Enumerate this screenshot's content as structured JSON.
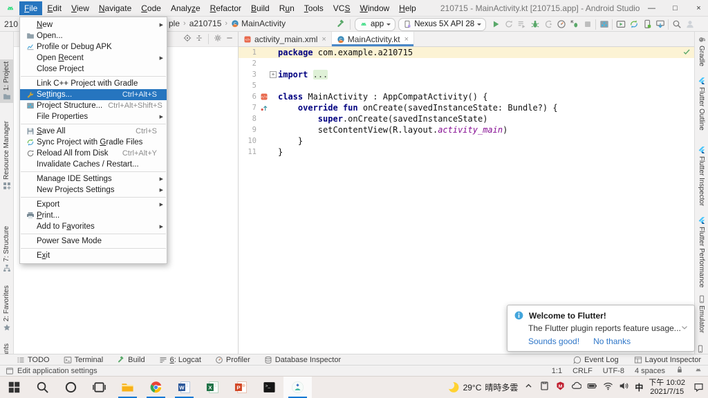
{
  "window": {
    "title": "210715 - MainActivity.kt [210715.app] - Android Studio"
  },
  "menubar": {
    "items": [
      {
        "label": "&File",
        "active": true
      },
      {
        "label": "&Edit"
      },
      {
        "label": "&View"
      },
      {
        "label": "&Navigate"
      },
      {
        "label": "&Code"
      },
      {
        "label": "Analy&ze"
      },
      {
        "label": "&Refactor"
      },
      {
        "label": "&Build"
      },
      {
        "label": "R&un"
      },
      {
        "label": "&Tools"
      },
      {
        "label": "VC&S"
      },
      {
        "label": "&Window"
      },
      {
        "label": "&Help"
      }
    ]
  },
  "navbar": {
    "left_fragment": "210",
    "crumbs": [
      {
        "label": "ple"
      },
      {
        "label": "a210715"
      },
      {
        "label": "MainActivity",
        "icon": "kotlinclass"
      }
    ],
    "separator": "›"
  },
  "toolbar": {
    "build_icon": "hammer",
    "run_config": {
      "icon": "android",
      "label": "app"
    },
    "device": {
      "icon": "device",
      "label": "Nexus 5X API 28"
    },
    "actions": [
      {
        "icon": "run",
        "name": "run-button"
      },
      {
        "icon": "rerun",
        "name": "rerun-button"
      },
      {
        "icon": "runlist",
        "name": "run-configurations-button"
      },
      {
        "icon": "debug",
        "name": "debug-button"
      },
      {
        "icon": "attach",
        "name": "attach-debugger-button"
      },
      {
        "icon": "profiler",
        "name": "profile-app-button"
      },
      {
        "icon": "debugattach",
        "name": "attach-profiler-button"
      },
      {
        "icon": "stop",
        "name": "stop-button"
      },
      "|",
      {
        "icon": "structure",
        "name": "project-structure-button"
      },
      "|",
      {
        "icon": "avd",
        "name": "avd-manager-button"
      },
      {
        "icon": "sync",
        "name": "gradle-sync-button"
      },
      {
        "icon": "devicemgr",
        "name": "device-manager-button"
      },
      {
        "icon": "sdk",
        "name": "sdk-manager-button"
      },
      "|",
      {
        "icon": "search",
        "name": "search-everywhere-button"
      },
      {
        "icon": "avatar",
        "name": "profile-avatar-button"
      }
    ]
  },
  "project_panel": {
    "header_actions": [
      {
        "icon": "target",
        "name": "locate-file-button"
      },
      {
        "icon": "collapseall",
        "name": "collapse-all-button"
      },
      "|",
      {
        "icon": "gear",
        "name": "panel-settings-button"
      },
      {
        "icon": "minus",
        "name": "hide-panel-button"
      }
    ]
  },
  "file_menu": {
    "items": [
      {
        "label": "&New",
        "submenu": true
      },
      {
        "label": "Open...",
        "icon": "folder"
      },
      {
        "label": "Profile or Debug APK",
        "icon": "apk"
      },
      {
        "label": "Open &Recent",
        "submenu": true
      },
      {
        "label": "Close Project",
        "sep_after": true
      },
      {
        "label": "Link C++ Project with Gradle"
      },
      {
        "label": "Se&ttings...",
        "icon": "wrench",
        "shortcut": "Ctrl+Alt+S",
        "selected": true
      },
      {
        "label": "Project Structure...",
        "icon": "structure",
        "shortcut": "Ctrl+Alt+Shift+S"
      },
      {
        "label": "File Properties",
        "submenu": true,
        "sep_after": true
      },
      {
        "label": "&Save All",
        "icon": "save",
        "shortcut": "Ctrl+S"
      },
      {
        "label": "Sync Project with &Gradle Files",
        "icon": "sync"
      },
      {
        "label": "Reload All from Disk",
        "icon": "reload",
        "shortcut": "Ctrl+Alt+Y"
      },
      {
        "label": "Invalidate Caches / Restart...",
        "sep_after": true
      },
      {
        "label": "Manage IDE Settings",
        "submenu": true
      },
      {
        "label": "New Projects Settings",
        "submenu": true,
        "sep_after": true
      },
      {
        "label": "Export",
        "submenu": true
      },
      {
        "label": "&Print...",
        "icon": "print"
      },
      {
        "label": "Add to F&avorites",
        "submenu": true,
        "sep_after": true
      },
      {
        "label": "Power Save Mode",
        "sep_after": true
      },
      {
        "label": "E&xit"
      }
    ]
  },
  "left_strip": {
    "items": [
      {
        "label": "1: Project",
        "icon": "folder",
        "active": true
      },
      {
        "label": "Resource Manager",
        "icon": "resmgr"
      },
      {
        "label": "7: Structure",
        "icon": "structtool"
      },
      {
        "label": "2: Favorites",
        "icon": "star"
      },
      {
        "label": "Build Variants",
        "icon": "buildvar"
      }
    ]
  },
  "right_strip": {
    "items": [
      {
        "label": "Gradle",
        "icon": "gradle"
      },
      {
        "label": "Flutter Outline",
        "icon": "flutter"
      },
      {
        "label": "Flutter Inspector",
        "icon": "flutter"
      },
      {
        "label": "Flutter Performance",
        "icon": "flutter"
      },
      {
        "label": "Emulator",
        "icon": "phone"
      }
    ],
    "corner_icon": "phone"
  },
  "editor": {
    "tabs": [
      {
        "label": "activity_main.xml",
        "icon": "xmlfile"
      },
      {
        "label": "MainActivity.kt",
        "icon": "kotlinclass",
        "active": true
      }
    ],
    "close_glyph": "×",
    "status_icon": "check",
    "lines": [
      {
        "n": "1",
        "hl": true,
        "seg": [
          {
            "c": "k",
            "t": "package"
          },
          {
            "t": " com.example.a210715"
          }
        ]
      },
      {
        "n": "2",
        "seg": []
      },
      {
        "n": "3",
        "fold": true,
        "seg": [
          {
            "c": "k",
            "t": "import"
          },
          {
            "t": " "
          },
          {
            "c": "fold",
            "t": "..."
          }
        ]
      },
      {
        "n": "5",
        "seg": []
      },
      {
        "n": "6",
        "gicon": "xmlfile",
        "seg": [
          {
            "c": "k",
            "t": "class"
          },
          {
            "t": " MainActivity : AppCompatActivity() {"
          }
        ]
      },
      {
        "n": "7",
        "gicon": "override",
        "seg": [
          {
            "t": "    "
          },
          {
            "c": "k",
            "t": "override"
          },
          {
            "t": " "
          },
          {
            "c": "k",
            "t": "fun"
          },
          {
            "t": " onCreate(savedInstanceState: Bundle?) {"
          }
        ]
      },
      {
        "n": "8",
        "seg": [
          {
            "t": "        "
          },
          {
            "c": "k",
            "t": "super"
          },
          {
            "t": ".onCreate(savedInstanceState)"
          }
        ]
      },
      {
        "n": "9",
        "seg": [
          {
            "t": "        setContentView(R.layout."
          },
          {
            "c": "it",
            "t": "activity_main"
          },
          {
            "t": ")"
          }
        ]
      },
      {
        "n": "10",
        "seg": [
          {
            "t": "    }"
          }
        ]
      },
      {
        "n": "11",
        "seg": [
          {
            "t": "}"
          }
        ]
      }
    ]
  },
  "notification": {
    "icon": "info",
    "title": "Welcome to Flutter!",
    "body": "The Flutter plugin reports feature usage...",
    "actions": [
      "Sounds good!",
      "No thanks"
    ]
  },
  "bottom_toolbar": {
    "left": [
      {
        "icon": "todo",
        "label": "TODO"
      },
      {
        "icon": "terminal",
        "label": "Terminal"
      },
      {
        "icon": "hammer",
        "label": "Build"
      },
      {
        "icon": "logcat",
        "label": "&6: Logcat"
      },
      {
        "icon": "profiler",
        "label": "Profiler"
      },
      {
        "icon": "dbinspector",
        "label": "Database Inspector"
      }
    ],
    "right": [
      {
        "icon": "eventlog",
        "label": "Event Log"
      },
      {
        "icon": "layoutinsp",
        "label": "Layout Inspector"
      }
    ]
  },
  "status_bar": {
    "message": {
      "icon": "appsettings",
      "label": "Edit application settings"
    },
    "right_values": [
      "1:1",
      "CRLF",
      "UTF-8",
      "4 spaces"
    ],
    "right_icons": [
      "lock",
      "androidgray"
    ]
  },
  "taskbar": {
    "apps": [
      {
        "name": "start-button",
        "icon": "start"
      },
      {
        "name": "search-button",
        "icon": "winsearch"
      },
      {
        "name": "cortana-button",
        "icon": "cortana"
      },
      {
        "name": "task-view-button",
        "icon": "taskview"
      },
      {
        "name": "file-explorer",
        "icon": "explorer",
        "running": true
      },
      {
        "name": "chrome",
        "icon": "chrome",
        "running": true
      },
      {
        "name": "word",
        "icon": "word",
        "running": true
      },
      {
        "name": "excel",
        "icon": "excel"
      },
      {
        "name": "powerpoint",
        "icon": "powerpoint"
      },
      {
        "name": "cmd",
        "icon": "cmd"
      },
      {
        "name": "android-studio",
        "icon": "androidstudio",
        "running": true,
        "active": true
      }
    ],
    "weather": {
      "icon": "moon",
      "temp": "29°C",
      "desc": "晴時多雲"
    },
    "tray": [
      {
        "name": "tray-expand",
        "icon": "chevup"
      },
      {
        "name": "tray-device",
        "icon": "traydevice"
      },
      {
        "name": "mcafee",
        "icon": "mcafee"
      },
      {
        "name": "onedrive",
        "icon": "onedrive"
      },
      {
        "name": "battery",
        "icon": "battery"
      },
      {
        "name": "wifi",
        "icon": "wifi"
      },
      {
        "name": "volume",
        "icon": "volume"
      }
    ],
    "ime": "中",
    "clock": {
      "time": "下午 10:02",
      "date": "2021/7/15"
    },
    "action_center_icon": "actioncenter"
  }
}
